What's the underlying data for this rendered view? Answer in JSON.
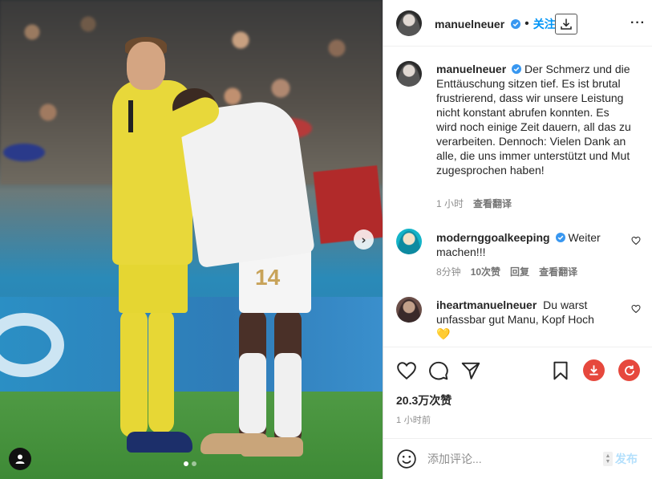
{
  "post": {
    "author": "manuelneuer",
    "verified": true,
    "follow_label": "关注",
    "separator": "•",
    "more_label": "···"
  },
  "caption": {
    "author": "manuelneuer",
    "text": "Der Schmerz und die Enttäuschung sitzen tief. Es ist brutal frustrierend, dass wir unsere Leistung nicht konstant abrufen konnten. Es wird noch einige Zeit dauern, all das zu verarbeiten. Dennoch: Vielen Dank an alle, die uns immer unterstützt und Mut zugesprochen haben!",
    "time": "1 小时",
    "translate": "查看翻译"
  },
  "comments": [
    {
      "author": "modernggoalkeeping",
      "verified": true,
      "text": "Weiter machen!!!",
      "time": "8分钟",
      "likes": "10次赞",
      "reply": "回复",
      "translate": "查看翻译"
    },
    {
      "author": "iheartmanuelneuer",
      "verified": false,
      "text": "Du warst unfassbar gut Manu, Kopf Hoch",
      "emoji": "💛"
    }
  ],
  "photo": {
    "jersey_number": "14",
    "carousel_count": 2,
    "carousel_active": 0
  },
  "stats": {
    "likes": "20.3万次赞",
    "posted": "1 小时前"
  },
  "composer": {
    "placeholder": "添加评论...",
    "publish_label": "发布"
  },
  "colors": {
    "accent": "#0095f6",
    "verified": "#3897f0",
    "action_red": "#e6483d",
    "text": "#262626",
    "muted": "#8e8e8e"
  }
}
